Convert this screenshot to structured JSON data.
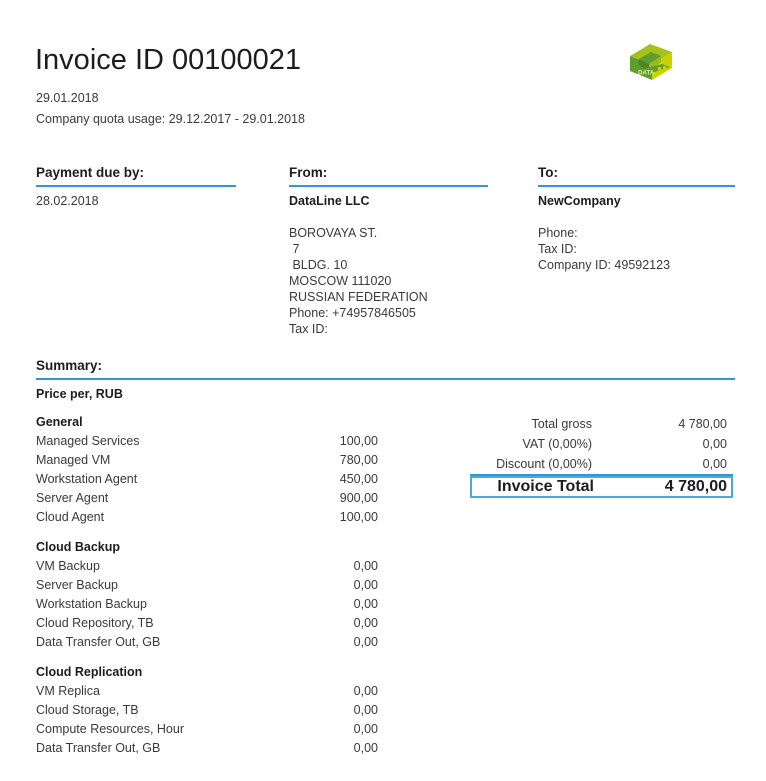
{
  "header": {
    "title": "Invoice ID 00100021",
    "date": "29.01.2018",
    "quota_usage": "Company quota usage: 29.12.2017 - 29.01.2018",
    "logo_text": "DATA LINE",
    "logo_colors": {
      "face": "#c9d300",
      "side": "#5d9e2e",
      "top": "#a8c11a"
    }
  },
  "accent_color": "#2e97d4",
  "payment": {
    "heading": "Payment due by:",
    "due_date": "28.02.2018"
  },
  "from": {
    "heading": "From:",
    "company": "DataLine LLC",
    "address_lines": [
      "BOROVAYA ST.",
      " 7",
      " BLDG. 10",
      "MOSCOW 111020",
      "RUSSIAN FEDERATION",
      "Phone: +74957846505",
      "Tax ID:"
    ]
  },
  "to": {
    "heading": "To:",
    "company": "NewCompany",
    "address_lines": [
      "Phone:",
      "Tax ID:",
      "Company ID: 49592123"
    ]
  },
  "summary": {
    "heading": "Summary:",
    "price_per": "Price per, RUB",
    "groups": [
      {
        "name": "General",
        "items": [
          {
            "label": "Managed Services",
            "value": "100,00"
          },
          {
            "label": "Managed VM",
            "value": "780,00"
          },
          {
            "label": "Workstation Agent",
            "value": "450,00"
          },
          {
            "label": "Server Agent",
            "value": "900,00"
          },
          {
            "label": "Cloud Agent",
            "value": "100,00"
          }
        ]
      },
      {
        "name": "Cloud Backup",
        "items": [
          {
            "label": "VM Backup",
            "value": "0,00"
          },
          {
            "label": "Server Backup",
            "value": "0,00"
          },
          {
            "label": "Workstation Backup",
            "value": "0,00"
          },
          {
            "label": "Cloud Repository, TB",
            "value": "0,00"
          },
          {
            "label": "Data Transfer Out, GB",
            "value": "0,00"
          }
        ]
      },
      {
        "name": "Cloud Replication",
        "items": [
          {
            "label": "VM Replica",
            "value": "0,00"
          },
          {
            "label": "Cloud Storage, TB",
            "value": "0,00"
          },
          {
            "label": "Compute Resources, Hour",
            "value": "0,00"
          },
          {
            "label": "Data Transfer Out, GB",
            "value": "0,00"
          }
        ]
      }
    ]
  },
  "totals": {
    "rows": [
      {
        "label": "Total gross",
        "value": "4 780,00"
      },
      {
        "label": "VAT (0,00%)",
        "value": "0,00"
      },
      {
        "label": "Discount (0,00%)",
        "value": "0,00"
      }
    ],
    "final": {
      "label": "Invoice Total",
      "value": "4 780,00"
    }
  }
}
